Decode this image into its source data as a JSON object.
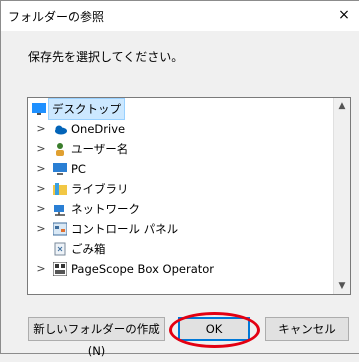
{
  "window": {
    "title": "フォルダーの参照",
    "close_glyph": "×"
  },
  "instruction": "保存先を選択してください。",
  "tree": {
    "items": [
      {
        "label": "デスクトップ",
        "icon": "desktop-icon",
        "selected": true,
        "chevron": ""
      },
      {
        "label": "OneDrive",
        "icon": "cloud-icon",
        "selected": false,
        "chevron": ">"
      },
      {
        "label": "ユーザー名",
        "icon": "user-icon",
        "selected": false,
        "chevron": ">"
      },
      {
        "label": "PC",
        "icon": "pc-icon",
        "selected": false,
        "chevron": ">"
      },
      {
        "label": "ライブラリ",
        "icon": "library-icon",
        "selected": false,
        "chevron": ">"
      },
      {
        "label": "ネットワーク",
        "icon": "network-icon",
        "selected": false,
        "chevron": ">"
      },
      {
        "label": "コントロール パネル",
        "icon": "control-panel-icon",
        "selected": false,
        "chevron": ">"
      },
      {
        "label": "ごみ箱",
        "icon": "recycle-bin-icon",
        "selected": false,
        "chevron": ""
      },
      {
        "label": "PageScope Box Operator",
        "icon": "app-icon",
        "selected": false,
        "chevron": ">"
      }
    ]
  },
  "buttons": {
    "new_folder": "新しいフォルダーの作成(N)",
    "ok": "OK",
    "cancel": "キャンセル"
  },
  "colors": {
    "highlight": "#e30012",
    "selection": "#cce8ff",
    "accent": "#0078d7"
  }
}
